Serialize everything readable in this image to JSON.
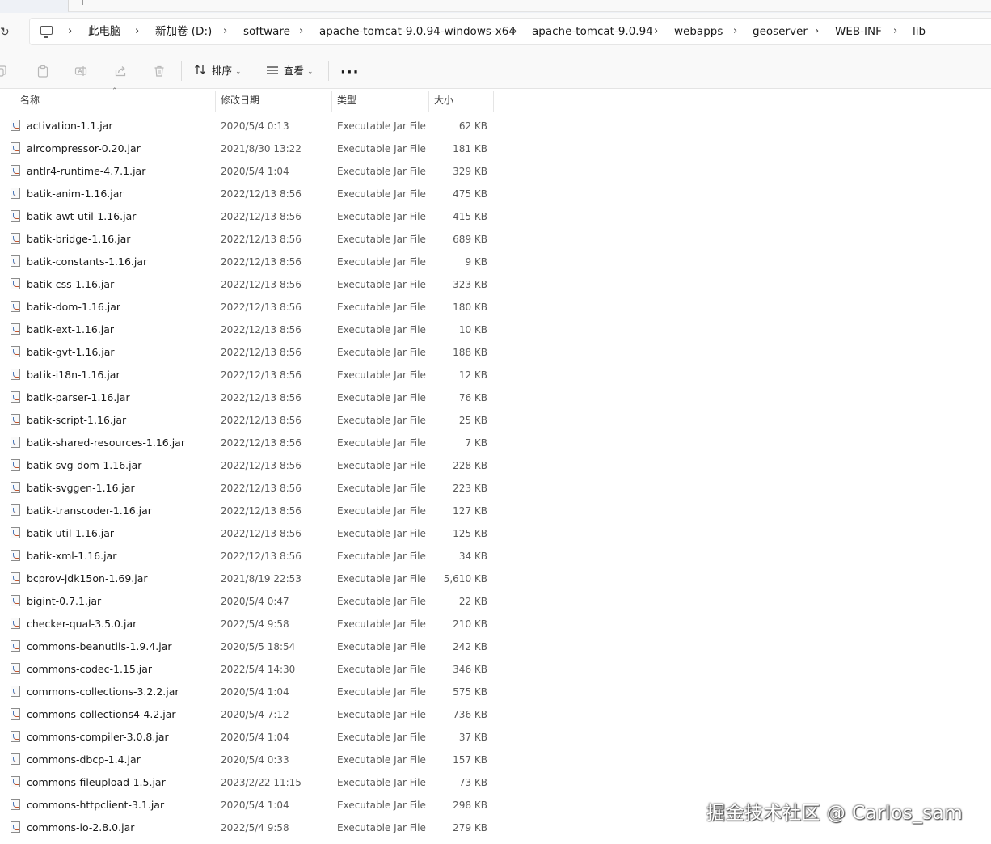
{
  "address": {
    "crumbs": [
      "此电脑",
      "新加卷 (D:)",
      "software",
      "apache-tomcat-9.0.94-windows-x64",
      "apache-tomcat-9.0.94",
      "webapps",
      "geoserver",
      "WEB-INF",
      "lib"
    ]
  },
  "toolbar": {
    "sort_label": "排序",
    "view_label": "查看",
    "more_label": "···"
  },
  "columns": {
    "name": "名称",
    "date": "修改日期",
    "type": "类型",
    "size": "大小"
  },
  "files": [
    {
      "name": "activation-1.1.jar",
      "date": "2020/5/4 0:13",
      "type": "Executable Jar File",
      "size": "62 KB"
    },
    {
      "name": "aircompressor-0.20.jar",
      "date": "2021/8/30 13:22",
      "type": "Executable Jar File",
      "size": "181 KB"
    },
    {
      "name": "antlr4-runtime-4.7.1.jar",
      "date": "2020/5/4 1:04",
      "type": "Executable Jar File",
      "size": "329 KB"
    },
    {
      "name": "batik-anim-1.16.jar",
      "date": "2022/12/13 8:56",
      "type": "Executable Jar File",
      "size": "475 KB"
    },
    {
      "name": "batik-awt-util-1.16.jar",
      "date": "2022/12/13 8:56",
      "type": "Executable Jar File",
      "size": "415 KB"
    },
    {
      "name": "batik-bridge-1.16.jar",
      "date": "2022/12/13 8:56",
      "type": "Executable Jar File",
      "size": "689 KB"
    },
    {
      "name": "batik-constants-1.16.jar",
      "date": "2022/12/13 8:56",
      "type": "Executable Jar File",
      "size": "9 KB"
    },
    {
      "name": "batik-css-1.16.jar",
      "date": "2022/12/13 8:56",
      "type": "Executable Jar File",
      "size": "323 KB"
    },
    {
      "name": "batik-dom-1.16.jar",
      "date": "2022/12/13 8:56",
      "type": "Executable Jar File",
      "size": "180 KB"
    },
    {
      "name": "batik-ext-1.16.jar",
      "date": "2022/12/13 8:56",
      "type": "Executable Jar File",
      "size": "10 KB"
    },
    {
      "name": "batik-gvt-1.16.jar",
      "date": "2022/12/13 8:56",
      "type": "Executable Jar File",
      "size": "188 KB"
    },
    {
      "name": "batik-i18n-1.16.jar",
      "date": "2022/12/13 8:56",
      "type": "Executable Jar File",
      "size": "12 KB"
    },
    {
      "name": "batik-parser-1.16.jar",
      "date": "2022/12/13 8:56",
      "type": "Executable Jar File",
      "size": "76 KB"
    },
    {
      "name": "batik-script-1.16.jar",
      "date": "2022/12/13 8:56",
      "type": "Executable Jar File",
      "size": "25 KB"
    },
    {
      "name": "batik-shared-resources-1.16.jar",
      "date": "2022/12/13 8:56",
      "type": "Executable Jar File",
      "size": "7 KB"
    },
    {
      "name": "batik-svg-dom-1.16.jar",
      "date": "2022/12/13 8:56",
      "type": "Executable Jar File",
      "size": "228 KB"
    },
    {
      "name": "batik-svggen-1.16.jar",
      "date": "2022/12/13 8:56",
      "type": "Executable Jar File",
      "size": "223 KB"
    },
    {
      "name": "batik-transcoder-1.16.jar",
      "date": "2022/12/13 8:56",
      "type": "Executable Jar File",
      "size": "127 KB"
    },
    {
      "name": "batik-util-1.16.jar",
      "date": "2022/12/13 8:56",
      "type": "Executable Jar File",
      "size": "125 KB"
    },
    {
      "name": "batik-xml-1.16.jar",
      "date": "2022/12/13 8:56",
      "type": "Executable Jar File",
      "size": "34 KB"
    },
    {
      "name": "bcprov-jdk15on-1.69.jar",
      "date": "2021/8/19 22:53",
      "type": "Executable Jar File",
      "size": "5,610 KB"
    },
    {
      "name": "bigint-0.7.1.jar",
      "date": "2020/5/4 0:47",
      "type": "Executable Jar File",
      "size": "22 KB"
    },
    {
      "name": "checker-qual-3.5.0.jar",
      "date": "2022/5/4 9:58",
      "type": "Executable Jar File",
      "size": "210 KB"
    },
    {
      "name": "commons-beanutils-1.9.4.jar",
      "date": "2020/5/5 18:54",
      "type": "Executable Jar File",
      "size": "242 KB"
    },
    {
      "name": "commons-codec-1.15.jar",
      "date": "2022/5/4 14:30",
      "type": "Executable Jar File",
      "size": "346 KB"
    },
    {
      "name": "commons-collections-3.2.2.jar",
      "date": "2020/5/4 1:04",
      "type": "Executable Jar File",
      "size": "575 KB"
    },
    {
      "name": "commons-collections4-4.2.jar",
      "date": "2020/5/4 7:12",
      "type": "Executable Jar File",
      "size": "736 KB"
    },
    {
      "name": "commons-compiler-3.0.8.jar",
      "date": "2020/5/4 1:04",
      "type": "Executable Jar File",
      "size": "37 KB"
    },
    {
      "name": "commons-dbcp-1.4.jar",
      "date": "2020/5/4 0:33",
      "type": "Executable Jar File",
      "size": "157 KB"
    },
    {
      "name": "commons-fileupload-1.5.jar",
      "date": "2023/2/22 11:15",
      "type": "Executable Jar File",
      "size": "73 KB"
    },
    {
      "name": "commons-httpclient-3.1.jar",
      "date": "2020/5/4 1:04",
      "type": "Executable Jar File",
      "size": "298 KB"
    },
    {
      "name": "commons-io-2.8.0.jar",
      "date": "2022/5/4 9:58",
      "type": "Executable Jar File",
      "size": "279 KB"
    }
  ],
  "watermark": "掘金技术社区 @ Carlos_sam"
}
